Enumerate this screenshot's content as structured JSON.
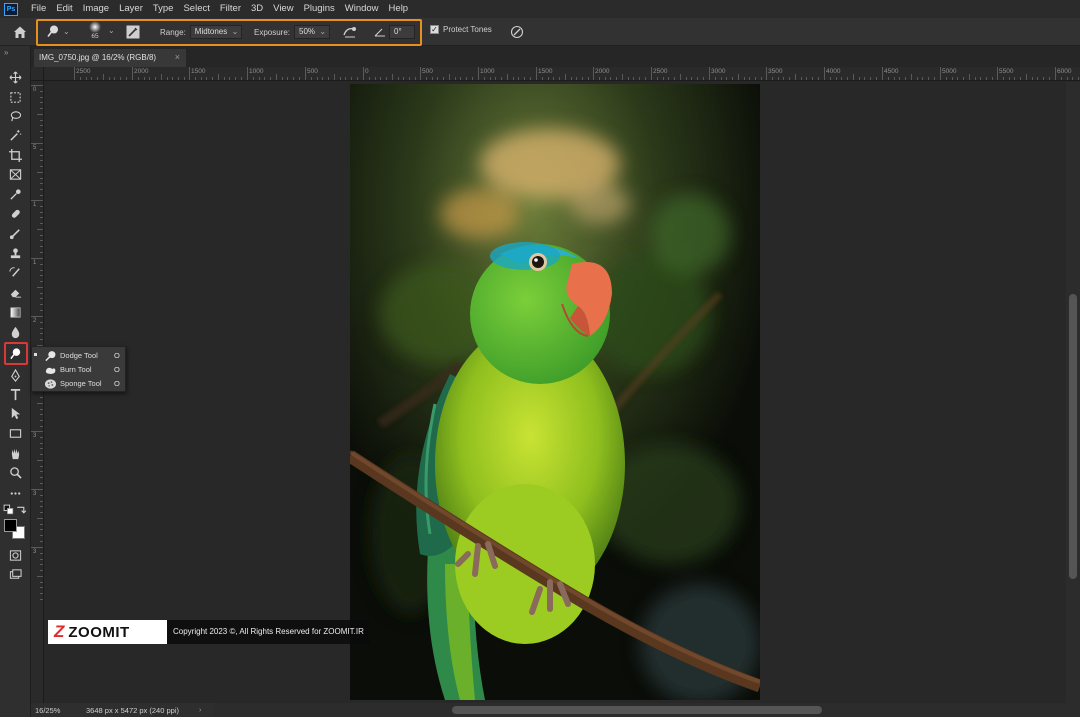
{
  "app": {
    "logo_text": "Ps"
  },
  "menubar": {
    "items": [
      "File",
      "Edit",
      "Image",
      "Layer",
      "Type",
      "Select",
      "Filter",
      "3D",
      "View",
      "Plugins",
      "Window",
      "Help"
    ]
  },
  "options": {
    "brush_size": "65",
    "range_label": "Range:",
    "range_value": "Midtones",
    "exposure_label": "Exposure:",
    "exposure_value": "50%",
    "angle_value": "0°",
    "protect_tones_label": "Protect Tones",
    "protect_tones_checked": true,
    "highlight_color": "#e8901e"
  },
  "document": {
    "tab_title": "IMG_0750.jpg @ 16/2% (RGB/8)",
    "zoom": "16/25%",
    "info": "3648 px x 5472 px (240 ppi)"
  },
  "ruler": {
    "h_labels": [
      "2500",
      "2000",
      "1500",
      "1000",
      "500",
      "0",
      "500",
      "1000",
      "1500",
      "2000",
      "2500",
      "3000",
      "3500",
      "4000",
      "4500",
      "5000",
      "5500",
      "6000"
    ],
    "v_labels": [
      "0",
      "5",
      "1",
      "1",
      "2",
      "2",
      "3",
      "3",
      "3"
    ]
  },
  "toolbar": {
    "active_tool": "dodge-tool",
    "highlight_color": "#d83a3a"
  },
  "flyout": {
    "items": [
      {
        "label": "Dodge Tool",
        "key": "O",
        "icon": "dodge-icon",
        "selected": true
      },
      {
        "label": "Burn Tool",
        "key": "O",
        "icon": "burn-icon",
        "selected": false
      },
      {
        "label": "Sponge Tool",
        "key": "O",
        "icon": "sponge-icon",
        "selected": false
      }
    ]
  },
  "watermark": {
    "logo_mark": "Z",
    "logo_name": "ZOOMIT",
    "copyright": "Copyright 2023 ©, All Rights Reserved for ZOOMIT.IR"
  }
}
